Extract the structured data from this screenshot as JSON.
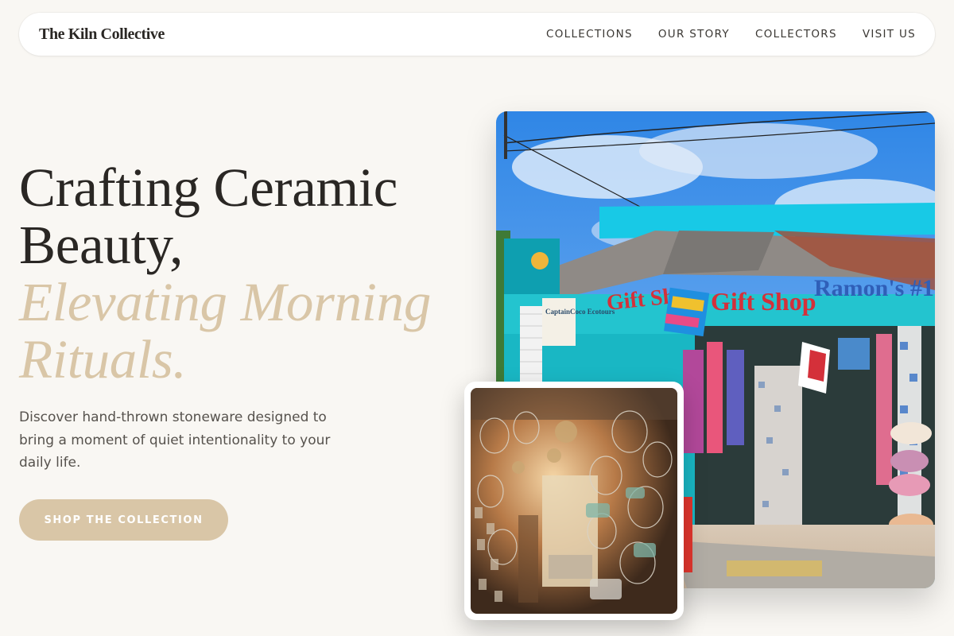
{
  "brand": {
    "name": "The Kiln Collective"
  },
  "nav": {
    "links": [
      {
        "label": "COLLECTIONS"
      },
      {
        "label": "OUR STORY"
      },
      {
        "label": "COLLECTORS"
      },
      {
        "label": "VISIT US"
      }
    ]
  },
  "hero": {
    "title_line1": "Crafting Ceramic",
    "title_line2": "Beauty,",
    "title_accent_line1": "Elevating Morning",
    "title_accent_line2": "Rituals.",
    "description": "Discover hand-thrown stoneware designed to bring a moment of quiet intentionality to your daily life.",
    "cta_label": "SHOP THE COLLECTION"
  },
  "images": {
    "main": {
      "sign_gift": "Gift Shop",
      "sign_gift_left": "Gift Sho",
      "sign_ramon": "Ramon's #1",
      "sign_captain": "CaptainCoco Ecotours"
    }
  },
  "colors": {
    "accent": "#d9c6a7",
    "background": "#f9f7f3",
    "text": "#2a2724"
  }
}
